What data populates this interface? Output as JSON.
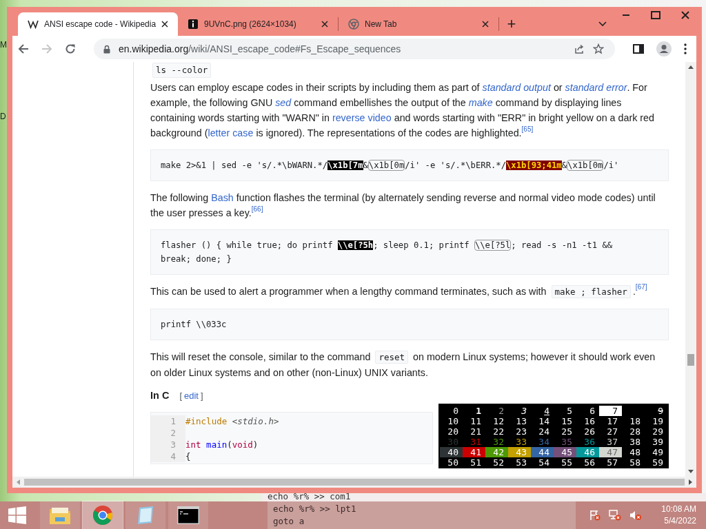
{
  "desktop_labels": [
    "M",
    "D"
  ],
  "browser": {
    "tabs": [
      {
        "title": "ANSI escape code - Wikipedia",
        "kind": "wikipedia",
        "selected": true
      },
      {
        "title": "9UVnC.png (2624×1034)",
        "kind": "info",
        "selected": false
      },
      {
        "title": "New Tab",
        "kind": "newtab",
        "selected": false
      }
    ],
    "new_tab": "+",
    "url": {
      "host": "en.wikipedia.org",
      "path": "/wiki/ANSI_escape_code#Fs_Escape_sequences"
    }
  },
  "article": {
    "top_code": "ls --color",
    "blocks": [
      {
        "kind": "para",
        "parts": [
          {
            "kind": "text",
            "text": "Users can employ escape codes in their scripts by including them as part of "
          },
          {
            "kind": "ilink",
            "text": "standard output"
          },
          {
            "kind": "text",
            "text": " or "
          },
          {
            "kind": "ilink",
            "text": "standard error"
          },
          {
            "kind": "text",
            "text": ". For example, the following GNU "
          },
          {
            "kind": "ilink",
            "text": "sed"
          },
          {
            "kind": "text",
            "text": " command embellishes the output of the "
          },
          {
            "kind": "ilink",
            "text": "make"
          },
          {
            "kind": "text",
            "text": " command by displaying lines containing words starting with \"WARN\" in "
          },
          {
            "kind": "link",
            "text": "reverse video"
          },
          {
            "kind": "text",
            "text": " and words starting with \"ERR\" in bright yellow on a dark red background ("
          },
          {
            "kind": "link",
            "text": "letter case"
          },
          {
            "kind": "text",
            "text": " is ignored). The representations of the codes are highlighted."
          },
          {
            "kind": "sup",
            "text": "[65]"
          }
        ]
      },
      {
        "kind": "code",
        "lines": [
          [
            {
              "kind": "plain",
              "text": "make 2>&1 | sed -e 's/.*\\bWARN.*/"
            },
            {
              "kind": "reverse",
              "text": "\\x1b[7m"
            },
            {
              "kind": "plain",
              "text": "&"
            },
            {
              "kind": "boxed",
              "text": "\\x1b[0m"
            },
            {
              "kind": "plain",
              "text": "/i' -e 's/.*\\bERR.*/"
            },
            {
              "kind": "alert",
              "text": "\\x1b[93;41m"
            },
            {
              "kind": "plain",
              "text": "&"
            },
            {
              "kind": "boxed",
              "text": "\\x1b[0m"
            },
            {
              "kind": "plain",
              "text": "/i'"
            }
          ]
        ]
      },
      {
        "kind": "para",
        "parts": [
          {
            "kind": "text",
            "text": "The following "
          },
          {
            "kind": "link",
            "text": "Bash"
          },
          {
            "kind": "text",
            "text": " function flashes the terminal (by alternately sending reverse and normal video mode codes) until the user presses a key."
          },
          {
            "kind": "sup",
            "text": "[66]"
          }
        ]
      },
      {
        "kind": "code",
        "lines": [
          [
            {
              "kind": "plain",
              "text": "flasher () { while true; do printf "
            },
            {
              "kind": "reverse",
              "text": "\\\\e[?5h"
            },
            {
              "kind": "plain",
              "text": "; sleep 0.1; printf "
            },
            {
              "kind": "boxed",
              "text": "\\\\e[?5l"
            },
            {
              "kind": "plain",
              "text": "; read -s -n1 -t1 &&"
            }
          ],
          [
            {
              "kind": "plain",
              "text": "break; done; }"
            }
          ]
        ]
      },
      {
        "kind": "para",
        "parts": [
          {
            "kind": "text",
            "text": "This can be used to alert a programmer when a lengthy command terminates, such as with "
          },
          {
            "kind": "code",
            "text": "make ; flasher"
          },
          {
            "kind": "cited",
            "text": ".$^{[67]}$"
          }
        ]
      },
      {
        "kind": "code",
        "lines": [
          [
            {
              "kind": "plain",
              "text": "printf \\\\033c"
            }
          ]
        ]
      },
      {
        "kind": "para",
        "parts": [
          {
            "kind": "text",
            "text": "This will reset the console, similar to the command "
          },
          {
            "kind": "code",
            "text": "reset"
          },
          {
            "kind": "text",
            "text": " on modern Linux systems; however it should work even on older Linux systems and on other (non-Linux) UNIX variants."
          }
        ]
      }
    ],
    "section": {
      "heading": "In C",
      "edit_open": "[",
      "edit": "edit",
      "edit_close": "]"
    },
    "c_code": [
      {
        "number": "1",
        "parts": [
          {
            "kind": "preproc",
            "text": "#include "
          },
          {
            "kind": "header",
            "text": "<stdio.h>"
          }
        ]
      },
      {
        "number": "2"
      },
      {
        "number": "3",
        "parts": [
          {
            "kind": "type",
            "text": "int "
          },
          {
            "kind": "func",
            "text": "main"
          },
          {
            "kind": "punct",
            "text": "("
          },
          {
            "kind": "type",
            "text": "void"
          },
          {
            "kind": "punct",
            "text": ")"
          }
        ]
      },
      {
        "number": "4",
        "parts": [
          {
            "kind": "punct",
            "text": "{"
          }
        ]
      }
    ],
    "color_table": [
      [
        {
          "text": "0",
          "kind": "normal"
        },
        {
          "text": "1",
          "kind": "bold"
        },
        {
          "text": "2",
          "kind": "faint"
        },
        {
          "text": "3",
          "kind": "italic"
        },
        {
          "text": "4",
          "kind": "underline"
        },
        {
          "text": "5",
          "kind": "normal"
        },
        {
          "text": "6",
          "kind": "normal"
        },
        {
          "text": "7",
          "kind": "reverse"
        },
        {
          "kind": "hidden"
        },
        {
          "text": "9",
          "kind": "strike"
        }
      ],
      [
        {
          "text": "10",
          "kind": "normal"
        },
        {
          "text": "11",
          "kind": "normal"
        },
        {
          "text": "12",
          "kind": "normal"
        },
        {
          "text": "13",
          "kind": "normal"
        },
        {
          "text": "14",
          "kind": "normal"
        },
        {
          "text": "15",
          "kind": "normal"
        },
        {
          "text": "16",
          "kind": "normal"
        },
        {
          "text": "17",
          "kind": "normal"
        },
        {
          "text": "18",
          "kind": "normal"
        },
        {
          "text": "19",
          "kind": "normal"
        }
      ],
      [
        {
          "text": "20",
          "kind": "normal"
        },
        {
          "text": "21",
          "kind": "normal"
        },
        {
          "text": "22",
          "kind": "normal"
        },
        {
          "text": "23",
          "kind": "normal"
        },
        {
          "text": "24",
          "kind": "normal"
        },
        {
          "text": "25",
          "kind": "normal"
        },
        {
          "text": "26",
          "kind": "normal"
        },
        {
          "text": "27",
          "kind": "normal"
        },
        {
          "text": "28",
          "kind": "normal"
        },
        {
          "text": "29",
          "kind": "normal"
        }
      ],
      [
        {
          "text": "30",
          "kind": "fg",
          "color": "#2e3436"
        },
        {
          "text": "31",
          "kind": "fg",
          "color": "#cc0000"
        },
        {
          "text": "32",
          "kind": "fg",
          "color": "#4e9a06"
        },
        {
          "text": "33",
          "kind": "fg",
          "color": "#c4a000"
        },
        {
          "text": "34",
          "kind": "fg",
          "color": "#3465a4"
        },
        {
          "text": "35",
          "kind": "fg",
          "color": "#75507b"
        },
        {
          "text": "36",
          "kind": "fg",
          "color": "#06989a"
        },
        {
          "text": "37",
          "kind": "fg",
          "color": "#d3d7cf"
        },
        {
          "text": "38",
          "kind": "normal"
        },
        {
          "text": "39",
          "kind": "normal"
        }
      ],
      [
        {
          "text": "40",
          "kind": "bg",
          "color": "#2e3436"
        },
        {
          "text": "41",
          "kind": "bg",
          "color": "#cc0000"
        },
        {
          "text": "42",
          "kind": "bg",
          "color": "#4e9a06"
        },
        {
          "text": "43",
          "kind": "bg",
          "color": "#c4a000"
        },
        {
          "text": "44",
          "kind": "bg",
          "color": "#3465a4"
        },
        {
          "text": "45",
          "kind": "bg",
          "color": "#75507b"
        },
        {
          "text": "46",
          "kind": "bg",
          "color": "#06989a"
        },
        {
          "text": "47",
          "kind": "bg",
          "color": "#d3d7cf"
        },
        {
          "text": "48",
          "kind": "normal"
        },
        {
          "text": "49",
          "kind": "normal"
        }
      ],
      [
        {
          "text": "50",
          "kind": "normal"
        },
        {
          "text": "51",
          "kind": "normal"
        },
        {
          "text": "52",
          "kind": "normal"
        },
        {
          "text": "53",
          "kind": "normal"
        },
        {
          "text": "54",
          "kind": "normal"
        },
        {
          "text": "55",
          "kind": "normal"
        },
        {
          "text": "56",
          "kind": "normal"
        },
        {
          "text": "57",
          "kind": "normal"
        },
        {
          "text": "58",
          "kind": "normal"
        },
        {
          "text": "59",
          "kind": "normal"
        }
      ]
    ]
  },
  "console_lines": [
    "echo %r% >> com1",
    "echo %r% >> lpt1",
    "goto a"
  ],
  "taskbar": {
    "apps": [
      {
        "kind": "explorer",
        "selected": false
      },
      {
        "kind": "chrome",
        "selected": true
      },
      {
        "kind": "notepad",
        "selected": false
      },
      {
        "kind": "cmd",
        "selected": false
      }
    ],
    "time": "10:08 AM",
    "date": "5/4/2022"
  }
}
